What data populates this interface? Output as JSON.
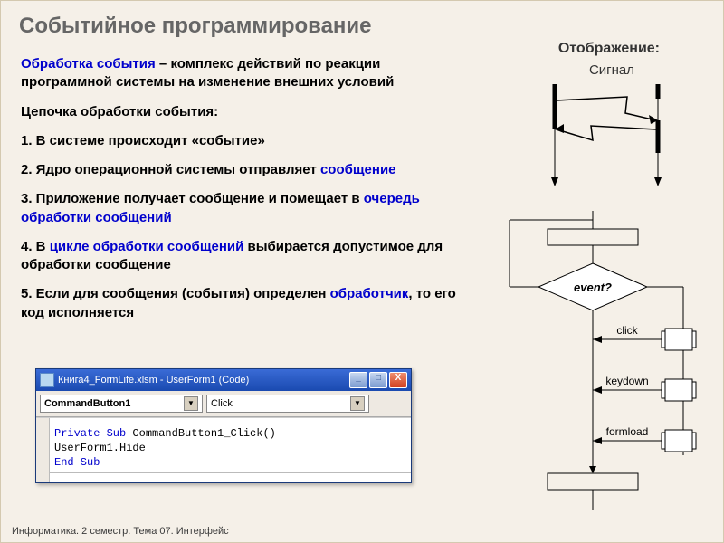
{
  "title": "Событийное программирование",
  "display_label": "Отображение:",
  "signal_label": "Сигнал",
  "definition_term": "Обработка события",
  "definition_rest": " – комплекс действий по реакции программной системы на изменение внешних условий",
  "chain_header": "Цепочка обработки события:",
  "steps": {
    "s1": "1. В системе происходит «событие»",
    "s2_a": "2. Ядро операционной системы отправляет ",
    "s2_b": "сообщение",
    "s3_a": "3. Приложение получает сообщение и помещает в ",
    "s3_b": "очередь обработки сообщений",
    "s4_a": "4. В ",
    "s4_b": "цикле обработки сообщений",
    "s4_c": " выбирается допустимое для обработки сообщение",
    "s5_a": "5. Если для сообщения (события) определен ",
    "s5_b": "обработчик",
    "s5_c": ", то его код исполняется"
  },
  "code_window": {
    "title": "Книга4_FormLife.xlsm - UserForm1 (Code)",
    "object_dropdown": "CommandButton1",
    "proc_dropdown": "Click",
    "code_lines": {
      "l1_a": "Private Sub",
      "l1_b": " CommandButton1_Click()",
      "l2": "  UserForm1.Hide",
      "l3": "End Sub"
    }
  },
  "flowchart": {
    "decision": "event?",
    "events": {
      "e1": "click",
      "e2": "keydown",
      "e3": "formload"
    }
  },
  "footer": "Информатика. 2 семестр. Тема 07. Интерфейс"
}
